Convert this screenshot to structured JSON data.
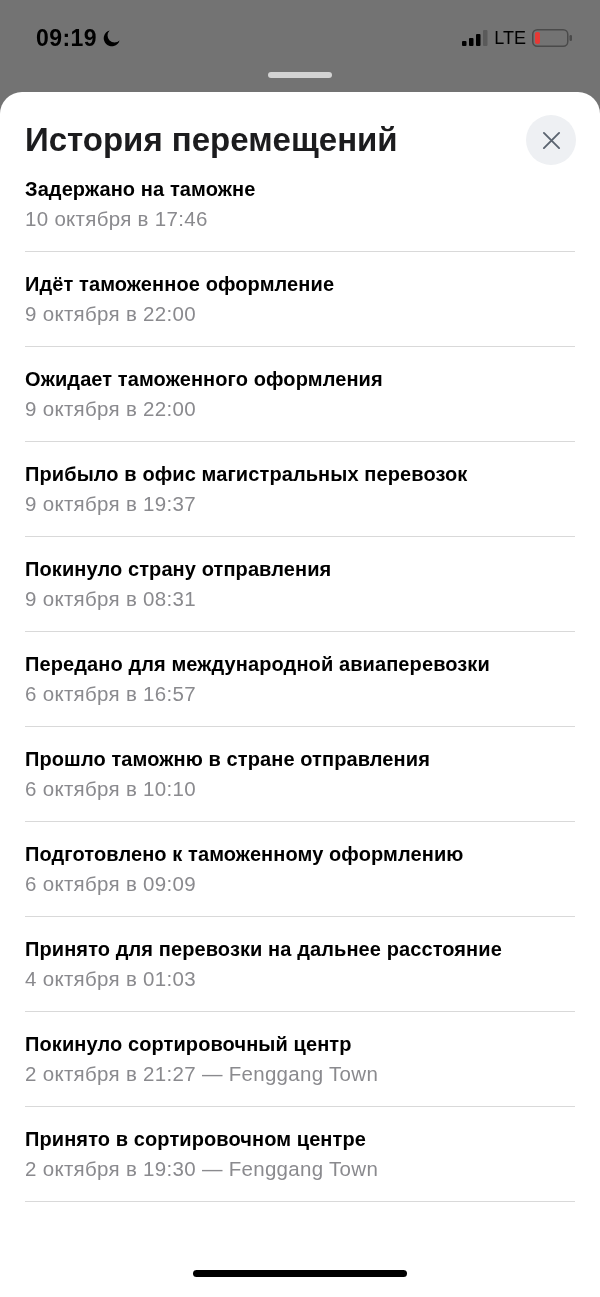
{
  "status_bar": {
    "time": "09:19",
    "network": "LTE"
  },
  "sheet": {
    "title": "История перемещений",
    "events": [
      {
        "title": "Задержано на таможне",
        "date": "10 октября в 17:46"
      },
      {
        "title": "Идёт таможенное оформление",
        "date": "9 октября в 22:00"
      },
      {
        "title": "Ожидает таможенного оформления",
        "date": "9 октября в 22:00"
      },
      {
        "title": "Прибыло в офис магистральных перевозок",
        "date": "9 октября в 19:37"
      },
      {
        "title": "Покинуло страну отправления",
        "date": "9 октября в 08:31"
      },
      {
        "title": "Передано для международной авиаперевозки",
        "date": "6 октября в 16:57"
      },
      {
        "title": "Прошло таможню в стране отправления",
        "date": "6 октября в 10:10"
      },
      {
        "title": "Подготовлено к таможенному оформлению",
        "date": "6 октября в 09:09"
      },
      {
        "title": "Принято для перевозки на дальнее расстояние",
        "date": "4 октября в 01:03"
      },
      {
        "title": "Покинуло сортировочный центр",
        "date": "2 октября в 21:27 — Fenggang Town"
      },
      {
        "title": "Принято в сортировочном центре",
        "date": "2 октября в 19:30 — Fenggang Town"
      }
    ]
  }
}
